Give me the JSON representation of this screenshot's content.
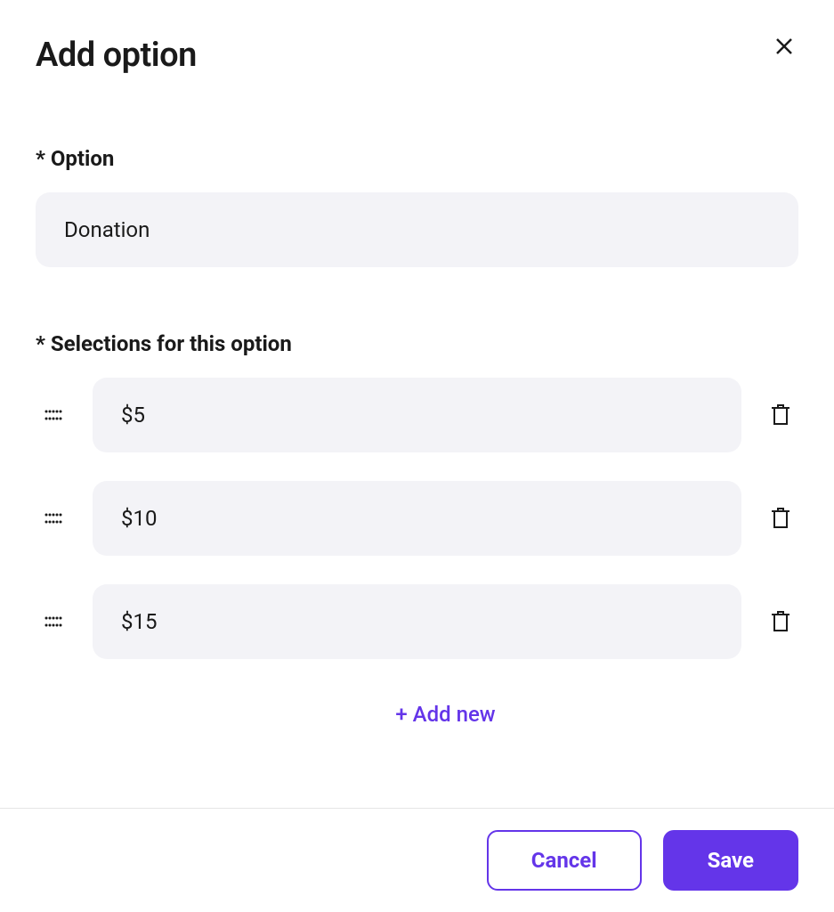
{
  "modal": {
    "title": "Add option"
  },
  "form": {
    "option_label": "* Option",
    "option_value": "Donation",
    "selections_label": "* Selections for this option",
    "selections": [
      {
        "value": "$5"
      },
      {
        "value": "$10"
      },
      {
        "value": "$15"
      }
    ],
    "add_new_label": "+ Add new"
  },
  "footer": {
    "cancel_label": "Cancel",
    "save_label": "Save"
  }
}
